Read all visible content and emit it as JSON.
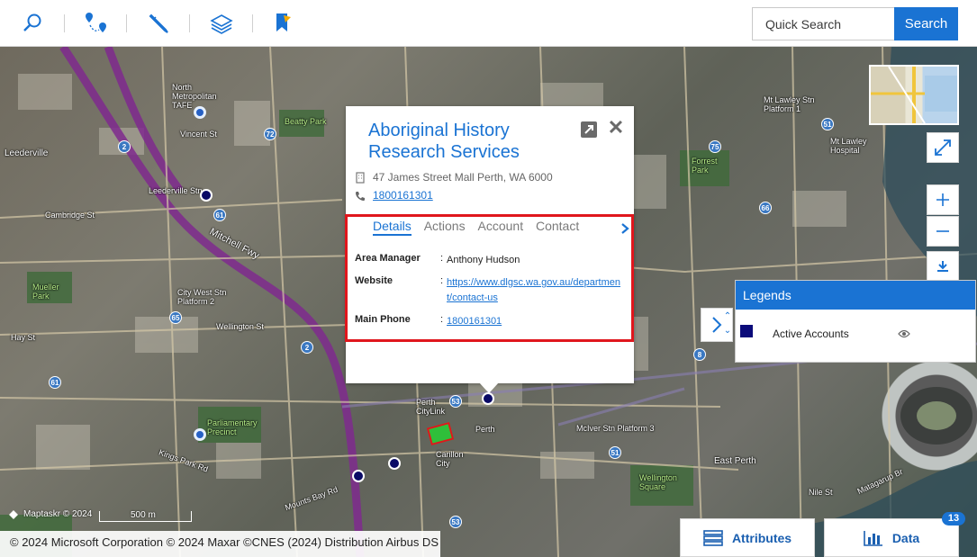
{
  "toolbar": {
    "tools": [
      "search-icon",
      "directions-icon",
      "pencil-icon",
      "layers-icon",
      "bookmark-pin-icon"
    ],
    "search_placeholder": "Quick Search",
    "search_button": "Search"
  },
  "map": {
    "labels": {
      "north_metropolitan": "North\nMetropolitan\nTAFE",
      "beatty_park": "Beatty Park",
      "leederville": "Leederville",
      "leederville_stn": "Leederville Stn",
      "cambridge_st": "Cambridge St",
      "mitchell_fwy": "Mitchell Fwy",
      "mueller_park": "Mueller\nPark",
      "city_west": "City West Stn\nPlatform 2",
      "parliamentary": "Parliamentary\nPrecinct",
      "perth": "Perth",
      "perth_citylink": "Perth\nCityLink",
      "carillon": "Carillon\nCity",
      "forrest_park": "Forrest\nPark",
      "mt_lawley": "Mt Lawley Stn\nPlatform 1",
      "mt_lawley_hospital": "Mt Lawley\nHospital",
      "east_perth": "East Perth",
      "wellington_square": "Wellington\nSquare",
      "mcIver": "McIver Stn Platform 3",
      "kings_park": "Kings Park Rd",
      "mounts_bay": "Mounts Bay Rd",
      "matagarup": "Matagarup Br",
      "nile_st": "Nile St",
      "vincent_st": "Vincent St",
      "wellington_st": "Wellington St",
      "hay_st": "Hay St"
    },
    "route_shields": [
      "2",
      "72",
      "75",
      "51",
      "61",
      "65",
      "2",
      "66",
      "8",
      "53",
      "51",
      "53",
      "61"
    ]
  },
  "popup": {
    "title": "Aboriginal History Research Services",
    "address": "47 James Street Mall Perth, WA 6000",
    "phone": "1800161301",
    "tabs": [
      "Details",
      "Actions",
      "Account",
      "Contact"
    ],
    "active_tab": "Details",
    "details": [
      {
        "key": "Area Manager",
        "value": "Anthony Hudson",
        "link": false
      },
      {
        "key": "Website",
        "value": "https://www.dlgsc.wa.gov.au/department/contact-us",
        "link": true
      },
      {
        "key": "Main Phone",
        "value": "1800161301",
        "link": true
      }
    ]
  },
  "legend": {
    "title": "Legends",
    "items": [
      {
        "label": "Active Accounts",
        "color": "#0b0b7a"
      }
    ]
  },
  "bottom": {
    "copyright": "© 2024 Microsoft Corporation © 2024 Maxar ©CNES (2024) Distribution Airbus DS",
    "maptaskr": "Maptaskr © 2024",
    "scale": "500 m",
    "attributes_label": "Attributes",
    "data_label": "Data",
    "data_count": "13"
  },
  "colors": {
    "accent": "#1a73d3",
    "highlight": "#e0161d",
    "marker": "#0b0b7a"
  }
}
